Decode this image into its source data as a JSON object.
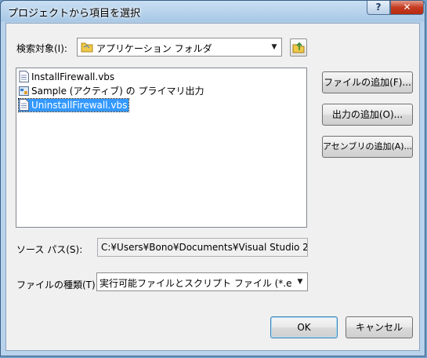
{
  "window": {
    "title": "プロジェクトから項目を選択",
    "help_label": "?",
    "close_label": "✕"
  },
  "look_in": {
    "label": "検索対象(I):",
    "value": "アプリケーション フォルダ",
    "up_icon": "folder-up-icon"
  },
  "file_list": [
    {
      "name": "InstallFirewall.vbs",
      "icon": "vbs-script-icon",
      "selected": false
    },
    {
      "name": "Sample (アクティブ) の プライマリ出力",
      "icon": "project-output-icon",
      "selected": false
    },
    {
      "name": "UninstallFirewall.vbs",
      "icon": "vbs-script-icon",
      "selected": true
    }
  ],
  "buttons": {
    "add_file": "ファイルの追加(F)...",
    "add_output": "出力の追加(O)...",
    "add_assembly": "アセンブリの追加(A)...",
    "ok": "OK",
    "cancel": "キャンセル"
  },
  "source_path": {
    "label": "ソース パス(S):",
    "value": "C:¥Users¥Bono¥Documents¥Visual Studio 20"
  },
  "file_type": {
    "label": "ファイルの種類(T):",
    "value": "実行可能ファイルとスクリプト ファイル (*.e"
  }
}
